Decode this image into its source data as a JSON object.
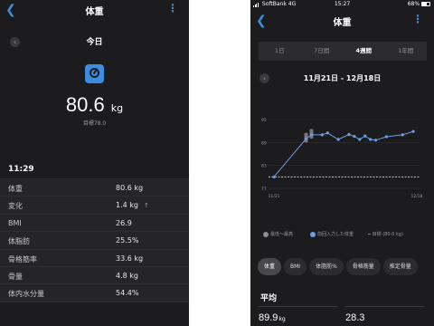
{
  "left": {
    "title": "体重",
    "back_icon": "chevron-left-icon",
    "more_icon": "vertical-dots-icon",
    "date_label": "今日",
    "main_value": "80.6",
    "main_unit": "kg",
    "goal_text": "目標78.0",
    "time": "11:29",
    "metrics": [
      {
        "key": "体重",
        "value": "80.6 kg",
        "arrow": ""
      },
      {
        "key": "変化",
        "value": "1.4 kg",
        "arrow": "↑"
      },
      {
        "key": "BMI",
        "value": "26.9",
        "arrow": ""
      },
      {
        "key": "体脂肪",
        "value": "25.5%",
        "arrow": ""
      },
      {
        "key": "骨格筋率",
        "value": "33.6 kg",
        "arrow": ""
      },
      {
        "key": "骨量",
        "value": "4.8 kg",
        "arrow": ""
      },
      {
        "key": "体内水分量",
        "value": "54.4%",
        "arrow": ""
      }
    ],
    "colors": {
      "accent": "#3b8de0",
      "bg": "#1c1c1e"
    }
  },
  "right": {
    "status": {
      "carrier": "SoftBank",
      "network": "4G",
      "time": "15:27",
      "battery": "68%",
      "battery_level": 0.68
    },
    "title": "体重",
    "tabs": [
      {
        "label": "1日",
        "active": false
      },
      {
        "label": "7日間",
        "active": false
      },
      {
        "label": "4週間",
        "active": true
      },
      {
        "label": "1年間",
        "active": false
      }
    ],
    "date_range": "11月21日 - 12月18日",
    "legend": [
      {
        "label": "最低～最高",
        "color": "#8e8e93",
        "shape": "dot"
      },
      {
        "label": "前回入力した体重",
        "color": "#6b9ee8",
        "shape": "dot"
      },
      {
        "label": "目標 (80.0 kg)",
        "color": "#cccccc",
        "shape": "dash"
      }
    ],
    "chips": [
      {
        "label": "体重",
        "active": true
      },
      {
        "label": "BMI",
        "active": false
      },
      {
        "label": "体脂肪%",
        "active": false
      },
      {
        "label": "骨格筋量",
        "active": false
      },
      {
        "label": "推定骨量",
        "active": false
      }
    ],
    "avg_title": "平均",
    "averages": [
      {
        "value": "89.9",
        "unit": "kg"
      },
      {
        "value": "28.3",
        "unit": ""
      }
    ]
  },
  "chart_data": {
    "type": "line",
    "title": "",
    "xlabel": "",
    "ylabel": "",
    "x_tick_labels": [
      "11/21",
      "12/18"
    ],
    "y_ticks": [
      77,
      83,
      89,
      95
    ],
    "ylim": [
      77,
      95
    ],
    "goal_line": 80,
    "series": [
      {
        "name": "前回入力した体重",
        "x": [
          1,
          7,
          8,
          10,
          11,
          13,
          15,
          16,
          17,
          18,
          19,
          20,
          22,
          25,
          27
        ],
        "y": [
          80.0,
          90.0,
          91.0,
          91.0,
          91.5,
          89.8,
          91.1,
          90.6,
          89.8,
          90.7,
          89.8,
          89.6,
          90.5,
          91.0,
          91.9
        ]
      },
      {
        "name": "最低～最高",
        "ranges": [
          {
            "x": 7,
            "min": 89.0,
            "max": 91.5
          },
          {
            "x": 8,
            "min": 90.0,
            "max": 92.5
          }
        ]
      }
    ],
    "x_range": [
      1,
      28
    ]
  }
}
